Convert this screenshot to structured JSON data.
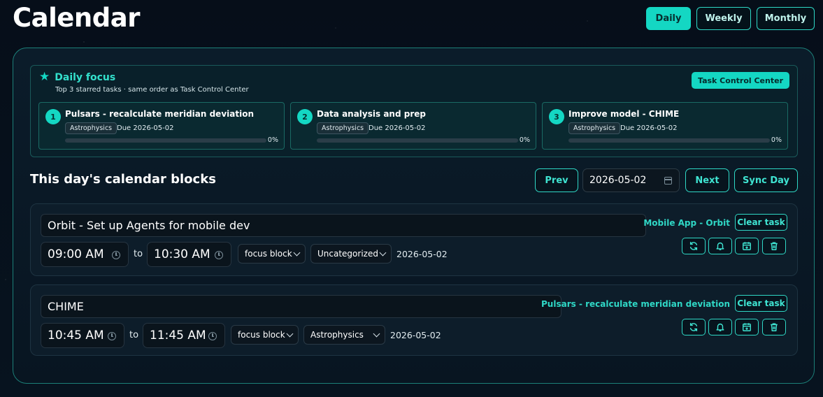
{
  "header": {
    "title": "Calendar",
    "views": [
      "Daily",
      "Weekly",
      "Monthly"
    ],
    "active_view": "Daily"
  },
  "focus": {
    "title": "Daily focus",
    "subtitle": "Top 3 starred tasks · same order as Task Control Center",
    "tcc_label": "Task Control Center",
    "cards": [
      {
        "num": "1",
        "title": "Pulsars - recalculate meridian deviation",
        "tag": "Astrophysics",
        "due": "Due 2026-05-02",
        "progress": 0,
        "pct": "0%"
      },
      {
        "num": "2",
        "title": "Data analysis and prep",
        "tag": "Astrophysics",
        "due": "Due 2026-05-02",
        "progress": 0,
        "pct": "0%"
      },
      {
        "num": "3",
        "title": "Improve model - CHIME",
        "tag": "Astrophysics",
        "due": "Due 2026-05-02",
        "progress": 0,
        "pct": "0%"
      }
    ]
  },
  "blocks_section": {
    "title": "This day's calendar blocks",
    "prev_label": "Prev",
    "date_value": "2026-05-02",
    "next_label": "Next",
    "sync_label": "Sync Day"
  },
  "blocks": [
    {
      "title": "Orbit - Set up Agents for mobile dev",
      "start": "09:00 AM",
      "to": "to",
      "end": "10:30 AM",
      "type": "focus block",
      "category": "Uncategorized",
      "date": "2026-05-02",
      "linked_task": "Mobile App - Orbit",
      "clear_label": "Clear task"
    },
    {
      "title": "CHIME",
      "start": "10:45 AM",
      "to": "to",
      "end": "11:45 AM",
      "type": "focus block",
      "category": "Astrophysics",
      "date": "2026-05-02",
      "linked_task": "Pulsars - recalculate meridian deviation",
      "clear_label": "Clear task"
    }
  ],
  "block_actions": [
    "sync-icon",
    "bell-icon",
    "calendar-plus-icon",
    "trash-icon"
  ],
  "colors": {
    "accent": "#14d7c3",
    "background": "#050d17",
    "panel_border": "#1c7f78"
  }
}
